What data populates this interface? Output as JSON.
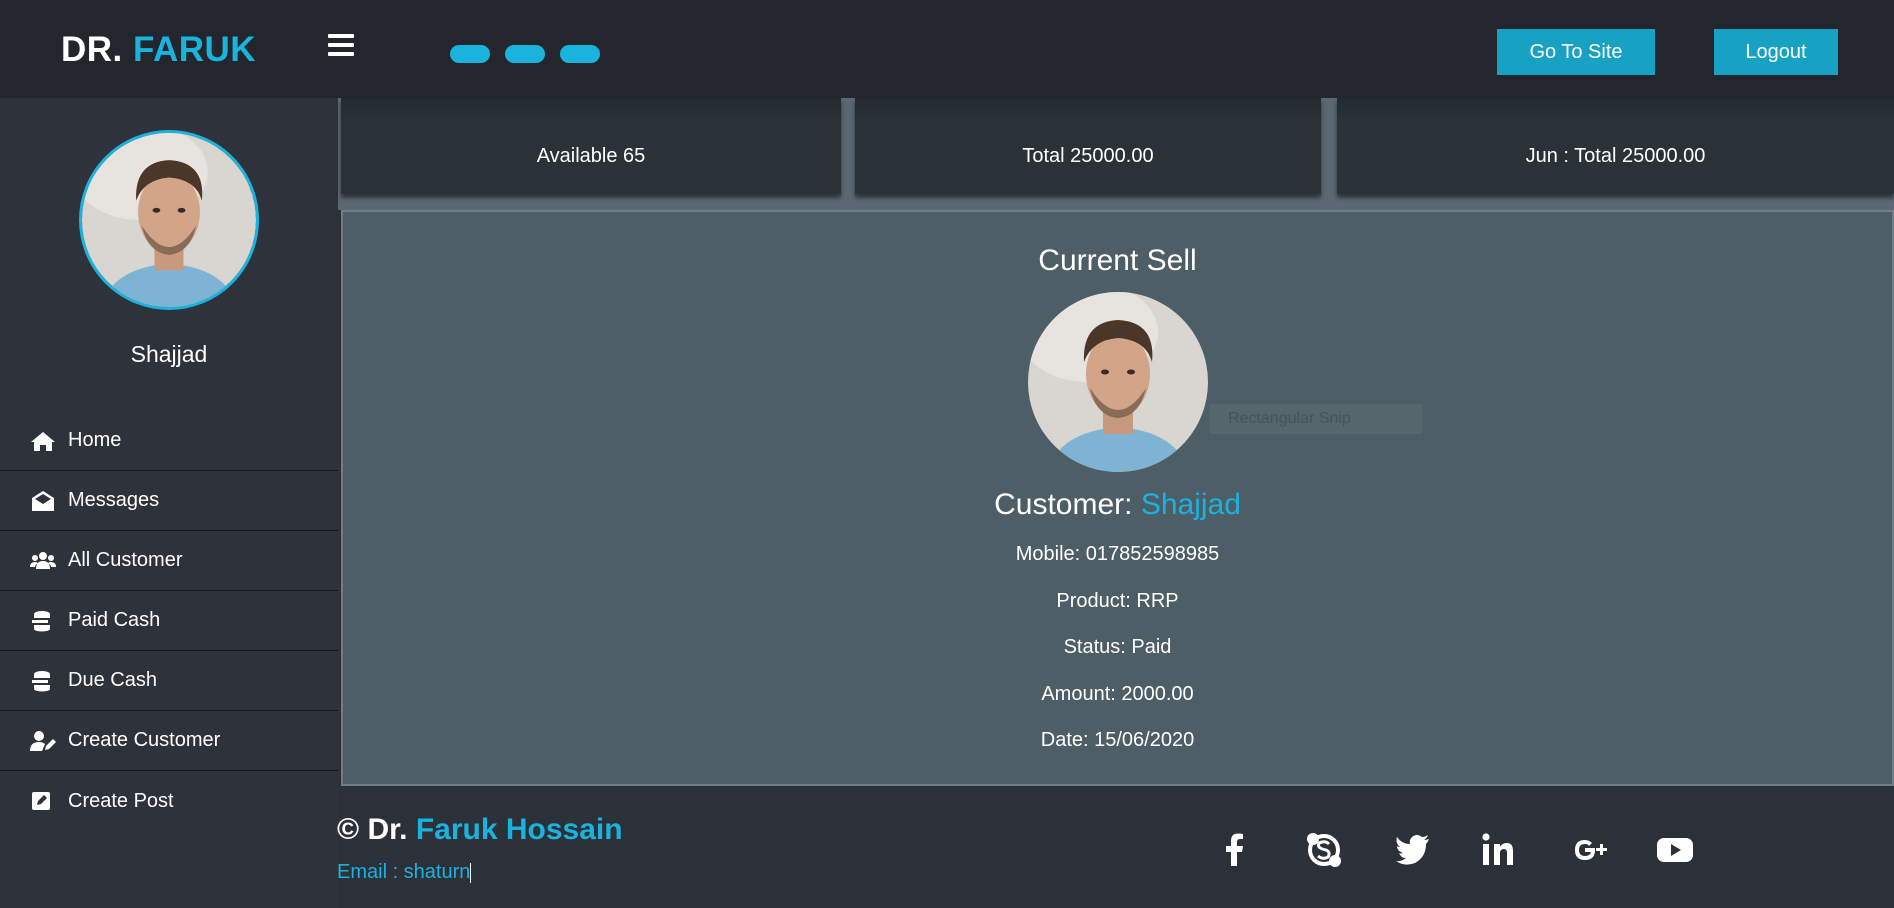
{
  "header": {
    "brand_part1": "DR.",
    "brand_part2": "FARUK",
    "go_to_site_label": "Go To Site",
    "logout_label": "Logout"
  },
  "sidebar": {
    "user_name": "Shajjad",
    "items": [
      {
        "label": "Home",
        "icon": "home-icon"
      },
      {
        "label": "Messages",
        "icon": "envelope-open-icon"
      },
      {
        "label": "All Customer",
        "icon": "users-icon"
      },
      {
        "label": "Paid Cash",
        "icon": "coins-icon"
      },
      {
        "label": "Due Cash",
        "icon": "coins-icon"
      },
      {
        "label": "Create Customer",
        "icon": "user-edit-icon"
      },
      {
        "label": "Create Post",
        "icon": "edit-icon"
      }
    ]
  },
  "stats": [
    {
      "label": "Available 65"
    },
    {
      "label": "Total 25000.00"
    },
    {
      "label": "Jun : Total 25000.00"
    }
  ],
  "current_sell": {
    "title": "Current Sell",
    "ghost_text": "Rectangular Snip",
    "customer_prefix": "Customer:",
    "customer_name": "Shajjad",
    "mobile": "Mobile: 017852598985",
    "product": "Product: RRP",
    "status": "Status: Paid",
    "amount": "Amount: 2000.00",
    "date": "Date: 15/06/2020"
  },
  "footer": {
    "copy_prefix": "© Dr.",
    "copy_name": "Faruk Hossain",
    "email": "Email : shaturn",
    "social": [
      "facebook-icon",
      "skype-icon",
      "twitter-icon",
      "linkedin-icon",
      "google-plus-icon",
      "youtube-icon"
    ]
  },
  "colors": {
    "accent": "#1ab3dd",
    "header_bg": "#23262d",
    "sidebar_bg": "#2e323b",
    "panel_bg": "#4d5e66"
  }
}
